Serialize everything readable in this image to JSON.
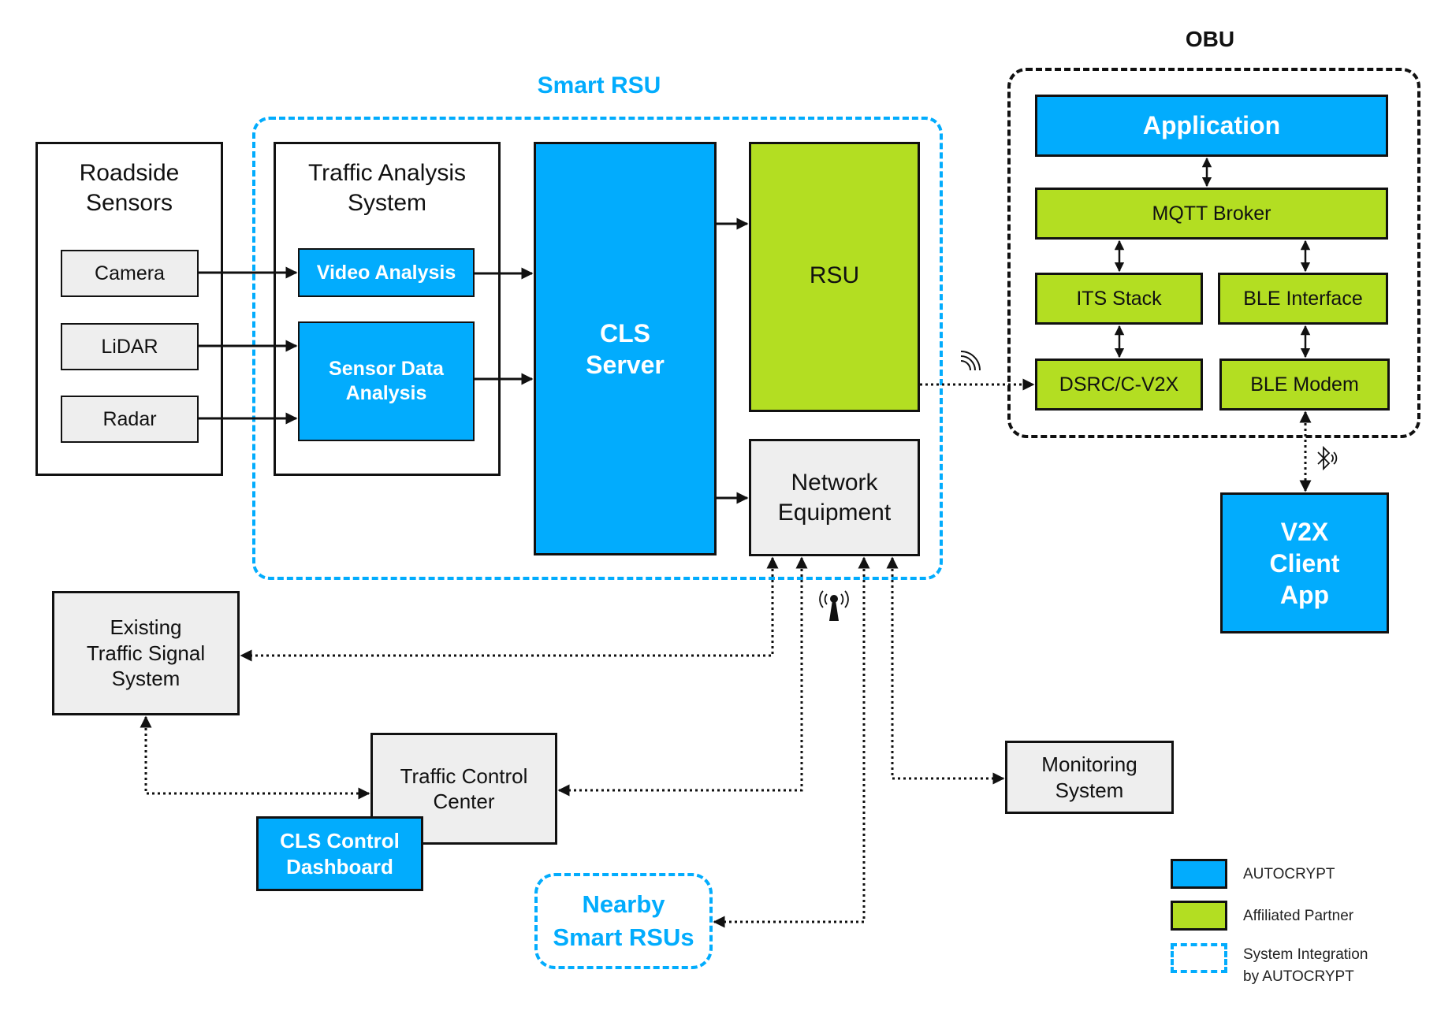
{
  "smart_rsu": {
    "title": "Smart RSU"
  },
  "obu": {
    "title": "OBU"
  },
  "roadside_sensors": {
    "title": "Roadside\nSensors",
    "items": [
      "Camera",
      "LiDAR",
      "Radar"
    ]
  },
  "traffic_analysis": {
    "title": "Traffic Analysis\nSystem",
    "video": "Video Analysis",
    "sensor": "Sensor Data\nAnalysis"
  },
  "cls_server": "CLS\nServer",
  "rsu": "RSU",
  "network_equipment": "Network\nEquipment",
  "obu_stack": {
    "application": "Application",
    "mqtt": "MQTT Broker",
    "its": "ITS Stack",
    "ble_interface": "BLE Interface",
    "dsrc": "DSRC/C-V2X",
    "ble_modem": "BLE Modem"
  },
  "v2x_client": "V2X\nClient\nApp",
  "existing_signal": "Existing\nTraffic Signal\nSystem",
  "traffic_control": "Traffic Control\nCenter",
  "cls_dashboard": "CLS Control\nDashboard",
  "nearby_rsus": "Nearby\nSmart RSUs",
  "monitoring": "Monitoring\nSystem",
  "icons": {
    "wireless": "wireless-signal-icon",
    "bluetooth": "bluetooth-icon",
    "antenna": "antenna-tower-icon"
  },
  "legend": {
    "items": [
      {
        "label": "AUTOCRYPT",
        "color": "#02acfd"
      },
      {
        "label": "Affiliated Partner",
        "color": "#b3de22"
      },
      {
        "label": "System Integration\nby AUTOCRYPT",
        "color": "#02acfd"
      }
    ]
  },
  "colors": {
    "autocrypt_blue": "#02acfd",
    "partner_green": "#b3de22",
    "neutral_gray": "#eeeeee"
  }
}
